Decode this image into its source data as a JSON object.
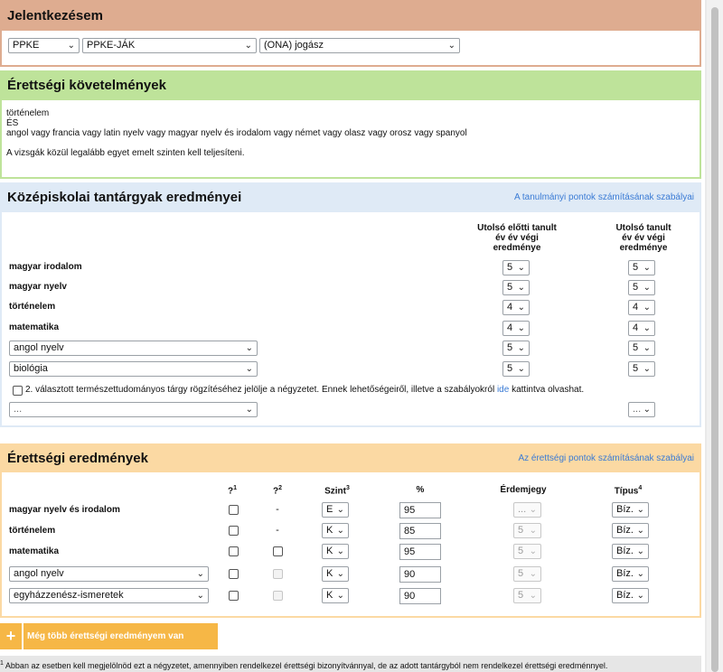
{
  "colors": {
    "jelentkezes": "#deac90",
    "kovetelmenyek": "#bee39a",
    "kozepiskolai": "#dfeaf6",
    "erettsegi": "#fbd9a3",
    "link": "#3a7bd5",
    "button": "#f6b746"
  },
  "jelentkezes": {
    "title": "Jelentkezésem",
    "institution": "PPKE",
    "faculty": "PPKE-JÁK",
    "program": "(ONA) jogász"
  },
  "kovetelmenyek": {
    "title": "Érettségi követelmények",
    "line1": "történelem",
    "line2": "ÉS",
    "line3": "angol vagy francia vagy latin nyelv vagy magyar nyelv és irodalom vagy német vagy olasz vagy orosz vagy spanyol",
    "note": "A vizsgák közül legalább egyet emelt szinten kell teljesíteni."
  },
  "kozepiskolai": {
    "title": "Középiskolai tantárgyak eredményei",
    "link": "A tanulmányi pontok számításának szabályai",
    "col1": [
      "Utolsó előtti tanult",
      "év év végi",
      "eredménye"
    ],
    "col2": [
      "Utolsó tanult",
      "év év végi",
      "eredménye"
    ],
    "rows": [
      {
        "subject": "magyar irodalom",
        "g1": "5",
        "g2": "5"
      },
      {
        "subject": "magyar nyelv",
        "g1": "5",
        "g2": "5"
      },
      {
        "subject": "történelem",
        "g1": "4",
        "g2": "4"
      },
      {
        "subject": "matematika",
        "g1": "4",
        "g2": "4"
      },
      {
        "subject": "angol nyelv",
        "g1": "5",
        "g2": "5"
      },
      {
        "subject": "biológia",
        "g1": "5",
        "g2": "5"
      }
    ],
    "checkbox_text_a": "2. választott természettudományos tárgy rögzítéséhez jelölje a négyzetet. Ennek lehetőségeiről, illetve a szabályokról",
    "checkbox_link": "ide",
    "checkbox_text_b": "kattintva olvashat.",
    "extra_subject": "...",
    "extra_grade": "..."
  },
  "erettsegi": {
    "title": "Érettségi eredmények",
    "link": "Az érettségi pontok számításának szabályai",
    "headers": {
      "q1": "?",
      "q1_sup": "1",
      "q2": "?",
      "q2_sup": "2",
      "szint": "Szint",
      "szint_sup": "3",
      "pct": "%",
      "erdemjegy": "Érdemjegy",
      "tipus": "Típus",
      "tipus_sup": "4"
    },
    "rows": [
      {
        "subject": "magyar nyelv és irodalom",
        "q2": "-",
        "szint": "E",
        "pct": "95",
        "jegy": "...",
        "tipus": "Bíz."
      },
      {
        "subject": "történelem",
        "q2": "-",
        "szint": "K",
        "pct": "85",
        "jegy": "5",
        "tipus": "Bíz."
      },
      {
        "subject": "matematika",
        "q2": "",
        "szint": "K",
        "pct": "95",
        "jegy": "5",
        "tipus": "Bíz."
      },
      {
        "subject": "angol nyelv",
        "q2": "",
        "szint": "K",
        "pct": "90",
        "jegy": "5",
        "tipus": "Bíz."
      },
      {
        "subject": "egyházzenész-ismeretek",
        "q2": "",
        "szint": "K",
        "pct": "90",
        "jegy": "5",
        "tipus": "Bíz."
      }
    ],
    "more_button": "Még több érettségi eredményem van",
    "plus": "+"
  },
  "footnote": {
    "sup": "1",
    "text": "Abban az esetben kell megjelölnöd ezt a négyzetet, amennyiben rendelkezel érettségi bizonyítvánnyal, de az adott tantárgyból nem rendelkezel érettségi eredménnyel."
  }
}
